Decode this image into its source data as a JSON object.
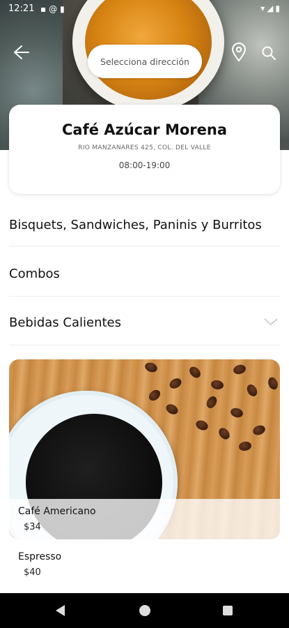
{
  "status_bar": {
    "time": "12:21",
    "left_icons": [
      "sim-icon",
      "at-icon",
      "sd-card-icon"
    ],
    "right_icons": [
      "wifi-icon",
      "signal-icon",
      "battery-icon"
    ]
  },
  "header": {
    "address_placeholder": "Selecciona dirección",
    "icons": [
      "back-arrow-icon",
      "location-pin-icon",
      "search-icon"
    ]
  },
  "store": {
    "name": "Café Azúcar Morena",
    "address": "RIO MANZANARES 425, COL. DEL VALLE",
    "hours": "08:00-19:00"
  },
  "categories": [
    {
      "label": "Bisquets, Sandwiches, Paninis y Burritos"
    },
    {
      "label": "Combos"
    },
    {
      "label": "Bebidas Calientes",
      "expanded": true
    }
  ],
  "products": [
    {
      "name": "Café Americano",
      "price": "$34"
    },
    {
      "name": "Espresso",
      "price": "$40"
    }
  ],
  "colors": {
    "accent": "#000000",
    "card": "#ffffff",
    "text": "#111111"
  }
}
